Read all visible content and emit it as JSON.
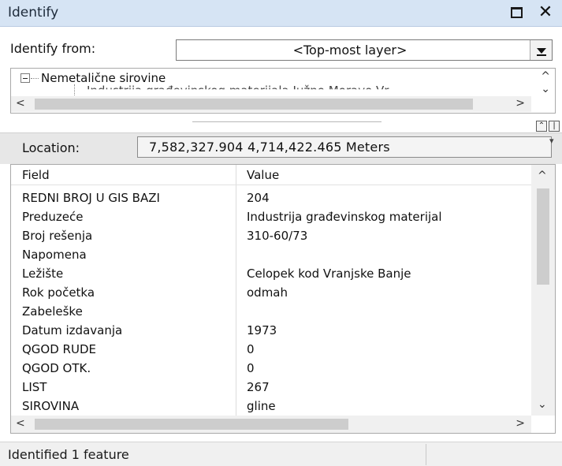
{
  "window": {
    "title": "Identify",
    "restore_icon": "restore-window-icon",
    "close_icon": "close-icon",
    "close_glyph": "✕"
  },
  "identify_from": {
    "label": "Identify from:",
    "selected": "<Top-most layer>"
  },
  "tree": {
    "root_label": "Nemetalične sirovine",
    "child_label": "Industrija građevinskog materijala Južno Moravo Vr"
  },
  "location": {
    "label": "Location:",
    "value": "7,582,327.904  4,714,422.465 Meters"
  },
  "table": {
    "columns": [
      "Field",
      "Value"
    ],
    "rows": [
      {
        "field": "REDNI BROJ U GIS BAZI",
        "value": "204"
      },
      {
        "field": "Preduzeće",
        "value": "Industrija građevinskog materijal"
      },
      {
        "field": "Broj rešenja",
        "value": "310-60/73"
      },
      {
        "field": "Napomena",
        "value": ""
      },
      {
        "field": "Ležište",
        "value": "Celopek kod Vranjske Banje"
      },
      {
        "field": "Rok početka",
        "value": "odmah"
      },
      {
        "field": "Zabeleške",
        "value": ""
      },
      {
        "field": "Datum izdavanja",
        "value": "1973"
      },
      {
        "field": "QGOD RUDE",
        "value": "0"
      },
      {
        "field": "QGOD OTK.",
        "value": "0"
      },
      {
        "field": "LIST",
        "value": "267"
      },
      {
        "field": "SIROVINA",
        "value": "gline"
      }
    ]
  },
  "status": {
    "text": "Identified 1 feature"
  },
  "glyphs": {
    "left": "<",
    "right": ">",
    "up": "^",
    "down": "⌄"
  },
  "colors": {
    "titlebar_bg": "#d6e4f4",
    "band_bg": "#e7e7e7",
    "scroll_thumb": "#cdcdcd"
  }
}
